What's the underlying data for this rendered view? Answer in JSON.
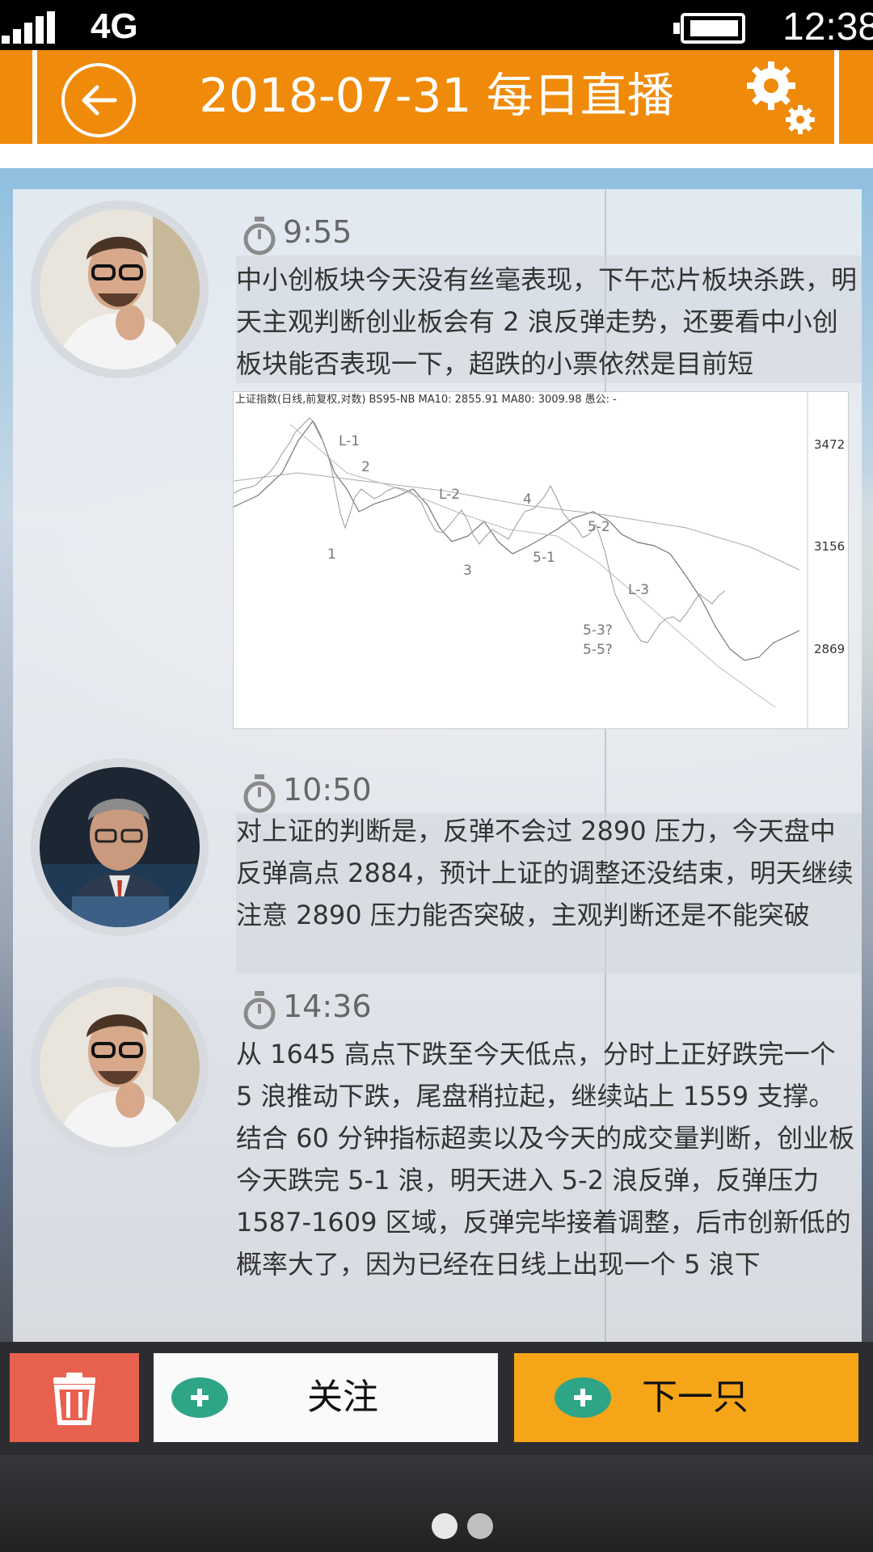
{
  "status_bar": {
    "network": "4G",
    "time": "12:38"
  },
  "header": {
    "title": "2018-07-31 每日直播"
  },
  "posts": [
    {
      "time": "9:55",
      "text": "中小创板块今天没有丝毫表现，下午芯片板块杀跌，明天主观判断创业板会有 2 浪反弹走势，还要看中小创板块能否表现一下，超跌的小票依然是目前短"
    },
    {
      "time": "10:50",
      "text": "对上证的判断是，反弹不会过 2890 压力，今天盘中反弹高点 2884，预计上证的调整还没结束，明天继续注意 2890 压力能否突破，主观判断还是不能突破"
    },
    {
      "time": "14:36",
      "text": "从 1645 高点下跌至今天低点，分时上正好跌完一个 5 浪推动下跌，尾盘稍拉起，继续站上 1559 支撑。结合 60 分钟指标超卖以及今天的成交量判断，创业板今天跌完 5-1 浪，明天进入 5-2 浪反弹，反弹压力 1587-1609 区域，反弹完毕接着调整，后市创新低的概率大了，因为已经在日线上出现一个 5 浪下"
    }
  ],
  "chart_image": {
    "header_text": "上证指数(日线,前复权,对数) BS95-NB MA10: 2855.91 MA80: 3009.98 愚公: -",
    "y_ticks": [
      "3472",
      "3156",
      "2869"
    ],
    "wave_labels": [
      "L-1",
      "2",
      "1",
      "L-2",
      "3",
      "4",
      "5-1",
      "5-2",
      "L-3",
      "5-3?",
      "5-5?"
    ]
  },
  "bottom_bar": {
    "follow_label": "关注",
    "next_label": "下一只"
  },
  "colors": {
    "header": "#f08a0a",
    "delete": "#e8614f",
    "next": "#f6a519",
    "plus": "#2fa588"
  },
  "icons": [
    "back-arrow-icon",
    "gear-icon",
    "timer-icon",
    "trash-icon",
    "plus-icon"
  ]
}
